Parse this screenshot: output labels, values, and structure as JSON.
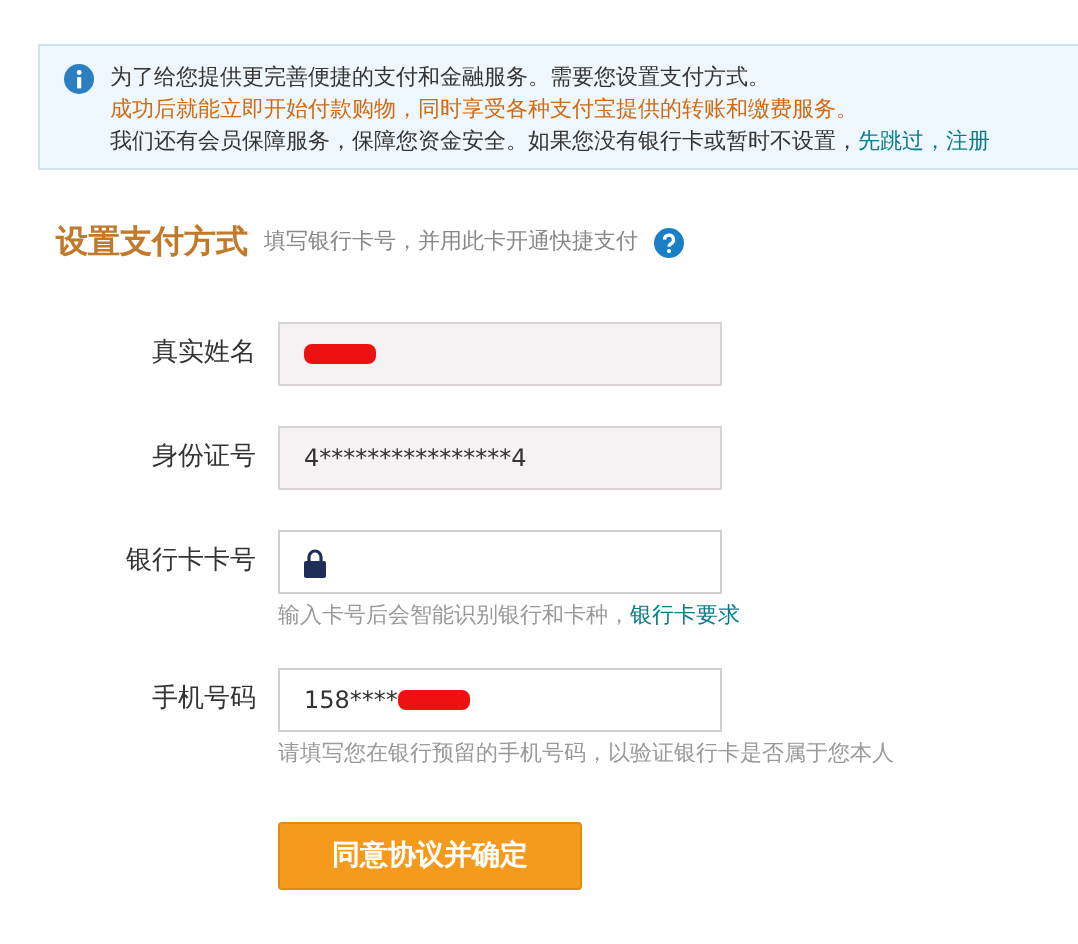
{
  "notice": {
    "lines": [
      {
        "kind": "plain",
        "text": "为了给您提供更完善便捷的支付和金融服务。需要您设置支付方式。"
      },
      {
        "kind": "highlight",
        "text": "成功后就能立即开始付款购物，同时享受各种支付宝提供的转账和缴费服务。"
      },
      {
        "kind": "plain",
        "text": "我们还有会员保障服务，保障您资金安全。如果您没有银行卡或暂时不设置，",
        "links": [
          "先跳过",
          "，",
          "注册"
        ]
      }
    ]
  },
  "section": {
    "title": "设置支付方式",
    "subtitle": "填写银行卡号，并用此卡开通快捷支付"
  },
  "fields": [
    {
      "label": "真实姓名",
      "disabled": true,
      "redacted": true
    },
    {
      "label": "身份证号",
      "value": "4****************4",
      "disabled": true
    },
    {
      "label": "银行卡卡号",
      "disabled": false,
      "lock": true,
      "hint": "输入卡号后会智能识别银行和卡种，",
      "hint_link": "银行卡要求"
    },
    {
      "label": "手机号码",
      "value": "158****",
      "disabled": false,
      "redacted": true,
      "hint": "请填写您在银行预留的手机号码，以验证银行卡是否属于您本人"
    }
  ],
  "submit": {
    "label": "同意协议并确定"
  }
}
